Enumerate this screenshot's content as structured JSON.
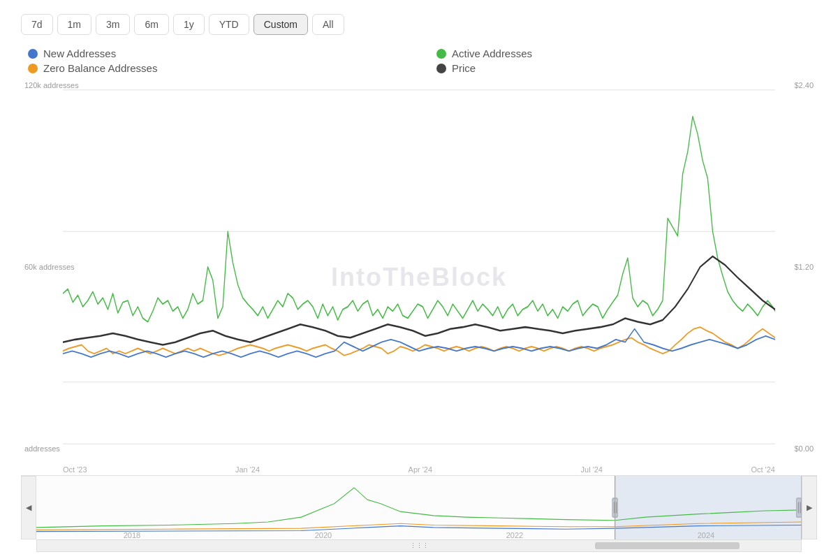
{
  "timeButtons": {
    "buttons": [
      "7d",
      "1m",
      "3m",
      "6m",
      "1y",
      "YTD",
      "Custom",
      "All"
    ],
    "active": "Custom"
  },
  "legend": {
    "items": [
      {
        "label": "New Addresses",
        "color": "#4477cc",
        "col": 0
      },
      {
        "label": "Active Addresses",
        "color": "#44bb44",
        "col": 1
      },
      {
        "label": "Zero Balance Addresses",
        "color": "#ee9922",
        "col": 0
      },
      {
        "label": "Price",
        "color": "#444444",
        "col": 1
      }
    ]
  },
  "yAxisLeft": {
    "labels": [
      "120k addresses",
      "60k addresses",
      "addresses"
    ]
  },
  "yAxisRight": {
    "labels": [
      "$2.40",
      "$1.20",
      "$0.00"
    ]
  },
  "xAxis": {
    "labels": [
      "Oct '23",
      "Jan '24",
      "Apr '24",
      "Jul '24",
      "Oct '24"
    ]
  },
  "miniXAxis": {
    "labels": [
      "2018",
      "2020",
      "2022",
      "2024"
    ]
  },
  "watermark": "IntoTheBlock",
  "miniChart": {
    "selectedStart": 0.755,
    "selectedEnd": 1.0
  }
}
